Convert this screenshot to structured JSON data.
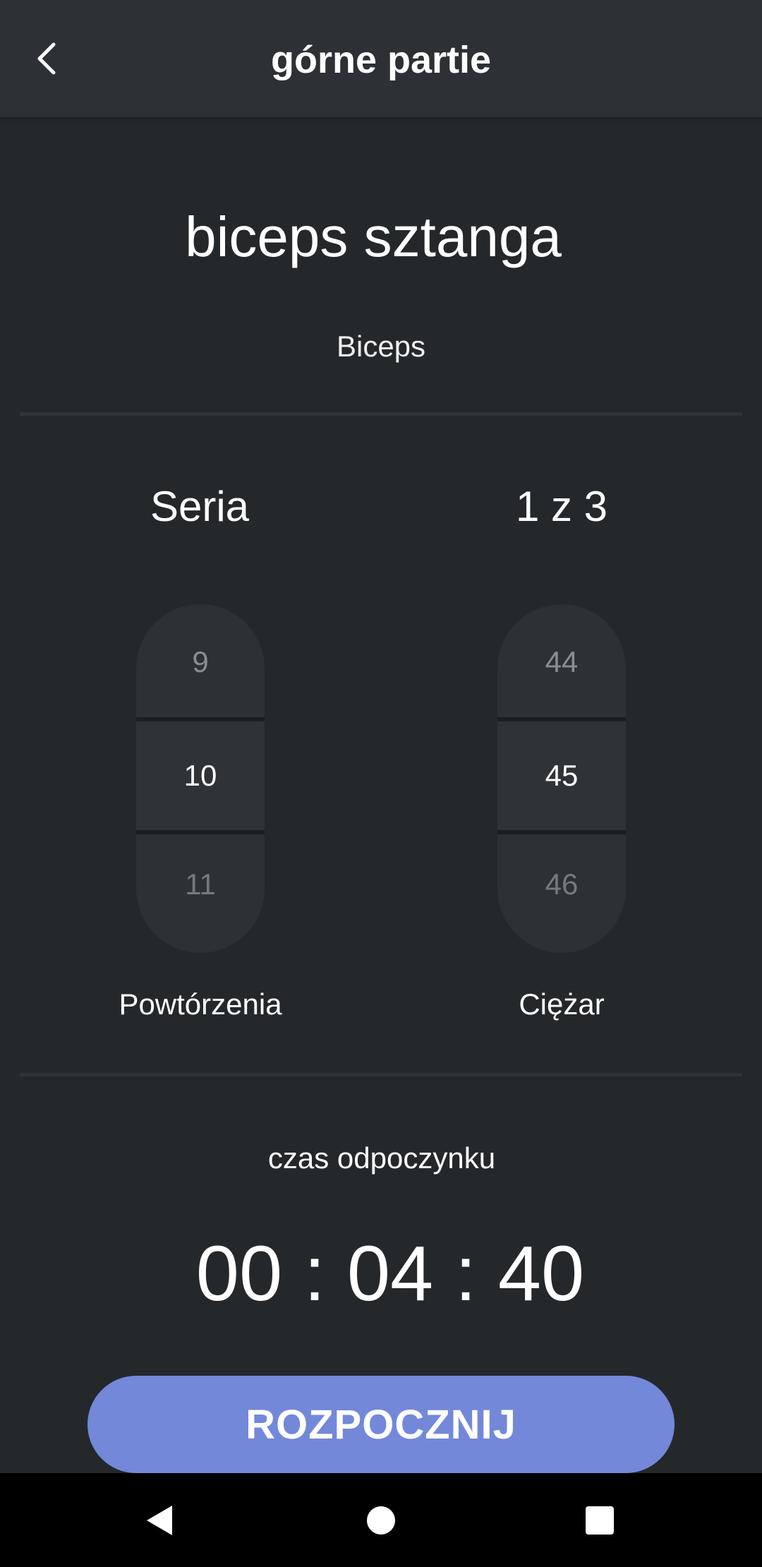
{
  "app_bar": {
    "title": "górne partie",
    "back_icon": "chevron-left-icon"
  },
  "exercise": {
    "name": "biceps sztanga",
    "muscle_group": "Biceps"
  },
  "series": {
    "label": "Seria",
    "progress": "1 z 3"
  },
  "reps_picker": {
    "prev": "9",
    "value": "10",
    "next": "11",
    "caption": "Powtórzenia"
  },
  "weight_picker": {
    "prev": "44",
    "value": "45",
    "next": "46",
    "caption": "Ciężar"
  },
  "rest": {
    "label": "czas odpoczynku",
    "time": "00 : 04 : 40"
  },
  "start_button": {
    "label": "ROZPOCZNIJ"
  },
  "nav_bar": {
    "back_icon": "triangle-back-icon",
    "home_icon": "circle-home-icon",
    "recents_icon": "square-recents-icon"
  },
  "colors": {
    "background": "#25282b",
    "app_bar": "#2d3034",
    "accent": "#7388d9",
    "picker": "#2d3034"
  }
}
